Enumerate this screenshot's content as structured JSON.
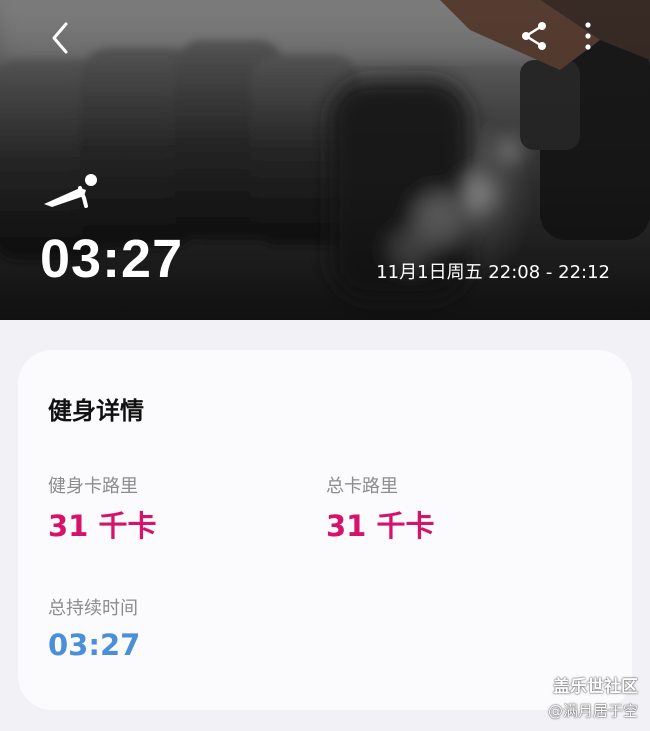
{
  "header": {
    "duration": "03:27",
    "datetime": "11月1日周五 22:08 - 22:12",
    "icons": {
      "back": "chevron-left-icon",
      "share": "share-icon",
      "more": "more-vertical-icon",
      "workout": "plank-workout-icon"
    }
  },
  "card": {
    "title": "健身详情",
    "metrics": [
      {
        "label": "健身卡路里",
        "value": "31 千卡"
      },
      {
        "label": "总卡路里",
        "value": "31 千卡"
      },
      {
        "label": "总持续时间",
        "value": "03:27"
      }
    ]
  },
  "watermark": {
    "title": "盖乐世社区",
    "user": "@满月居于空"
  },
  "colors": {
    "calorie": "#d6136b",
    "duration": "#4a8fd8",
    "page_background": "#f2f1f6",
    "card_background": "#fbfafd"
  }
}
